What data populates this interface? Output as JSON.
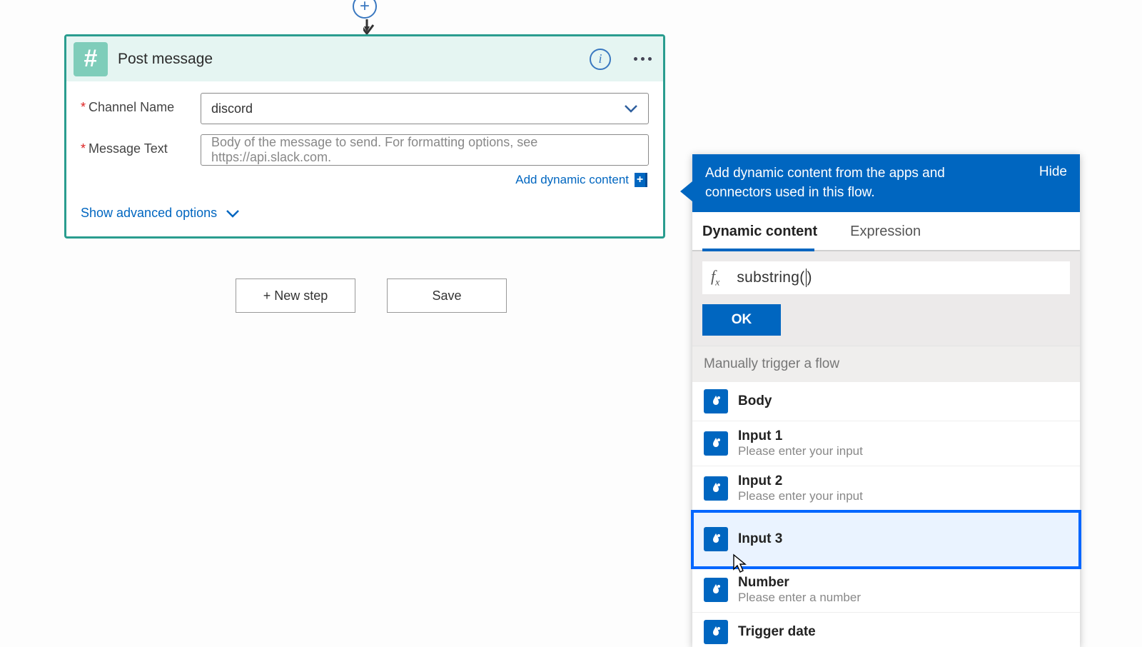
{
  "card": {
    "title": "Post message",
    "fields": {
      "channel_label": "Channel Name",
      "channel_value": "discord",
      "message_label": "Message Text",
      "message_placeholder": "Body of the message to send. For formatting options, see https://api.slack.com."
    },
    "add_dynamic_label": "Add dynamic content",
    "show_advanced_label": "Show advanced options"
  },
  "buttons": {
    "new_step": "+ New step",
    "save": "Save"
  },
  "panel": {
    "header_text": "Add dynamic content from the apps and connectors used in this flow.",
    "hide_label": "Hide",
    "tabs": {
      "dynamic": "Dynamic content",
      "expression": "Expression"
    },
    "fx_prefix": "substring(",
    "fx_suffix": ")",
    "ok_label": "OK",
    "group_title": "Manually trigger a flow",
    "items": [
      {
        "title": "Body",
        "desc": ""
      },
      {
        "title": "Input 1",
        "desc": "Please enter your input"
      },
      {
        "title": "Input 2",
        "desc": "Please enter your input"
      },
      {
        "title": "Input 3",
        "desc": ""
      },
      {
        "title": "Number",
        "desc": "Please enter a number"
      },
      {
        "title": "Trigger date",
        "desc": ""
      }
    ]
  }
}
